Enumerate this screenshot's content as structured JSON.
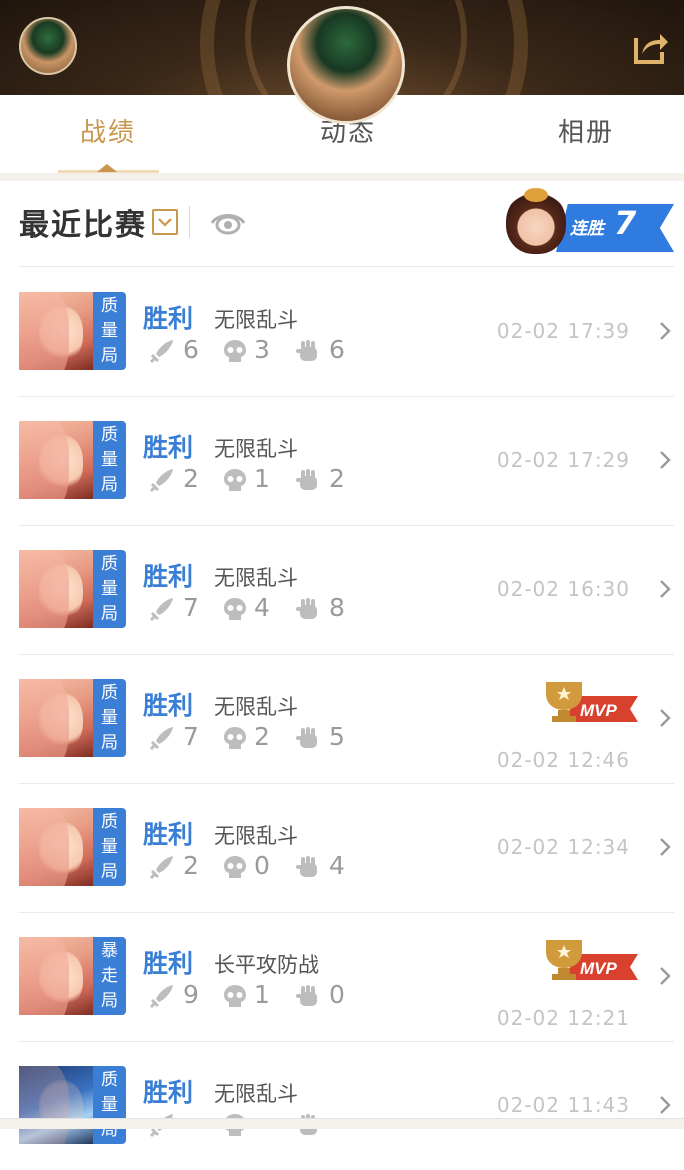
{
  "tabs": [
    {
      "label": "战绩",
      "active": true
    },
    {
      "label": "动态",
      "active": false
    },
    {
      "label": "相册",
      "active": false
    }
  ],
  "recent": {
    "title": "最近比赛",
    "streak_label": "连胜",
    "streak_count": "7"
  },
  "icons": {
    "share": "share-icon",
    "dropdown": "chevron-down-icon",
    "eye": "eye-icon",
    "kill": "sword-icon",
    "death": "skull-icon",
    "assist": "fist-icon",
    "mvp": "trophy-mvp-icon",
    "chevron": "chevron-right-icon"
  },
  "colors": {
    "accent": "#c8964c",
    "win_blue": "#3a7fd5",
    "mvp_red": "#d9412f"
  },
  "mvp_label": "MVP",
  "matches": [
    {
      "result": "胜利",
      "mode": "无限乱斗",
      "badge": [
        "质",
        "量",
        "局"
      ],
      "kills": "6",
      "deaths": "3",
      "assists": "6",
      "time": "02-02  17:39",
      "mvp": false
    },
    {
      "result": "胜利",
      "mode": "无限乱斗",
      "badge": [
        "质",
        "量",
        "局"
      ],
      "kills": "2",
      "deaths": "1",
      "assists": "2",
      "time": "02-02  17:29",
      "mvp": false
    },
    {
      "result": "胜利",
      "mode": "无限乱斗",
      "badge": [
        "质",
        "量",
        "局"
      ],
      "kills": "7",
      "deaths": "4",
      "assists": "8",
      "time": "02-02  16:30",
      "mvp": false
    },
    {
      "result": "胜利",
      "mode": "无限乱斗",
      "badge": [
        "质",
        "量",
        "局"
      ],
      "kills": "7",
      "deaths": "2",
      "assists": "5",
      "time": "02-02  12:46",
      "mvp": true
    },
    {
      "result": "胜利",
      "mode": "无限乱斗",
      "badge": [
        "质",
        "量",
        "局"
      ],
      "kills": "2",
      "deaths": "0",
      "assists": "4",
      "time": "02-02  12:34",
      "mvp": false
    },
    {
      "result": "胜利",
      "mode": "长平攻防战",
      "badge": [
        "暴",
        "走",
        "局"
      ],
      "kills": "9",
      "deaths": "1",
      "assists": "0",
      "time": "02-02  12:21",
      "mvp": true
    },
    {
      "result": "胜利",
      "mode": "无限乱斗",
      "badge": [
        "质",
        "量",
        "局"
      ],
      "kills": "",
      "deaths": "",
      "assists": "",
      "time": "02-02  11:43",
      "mvp": false
    }
  ]
}
